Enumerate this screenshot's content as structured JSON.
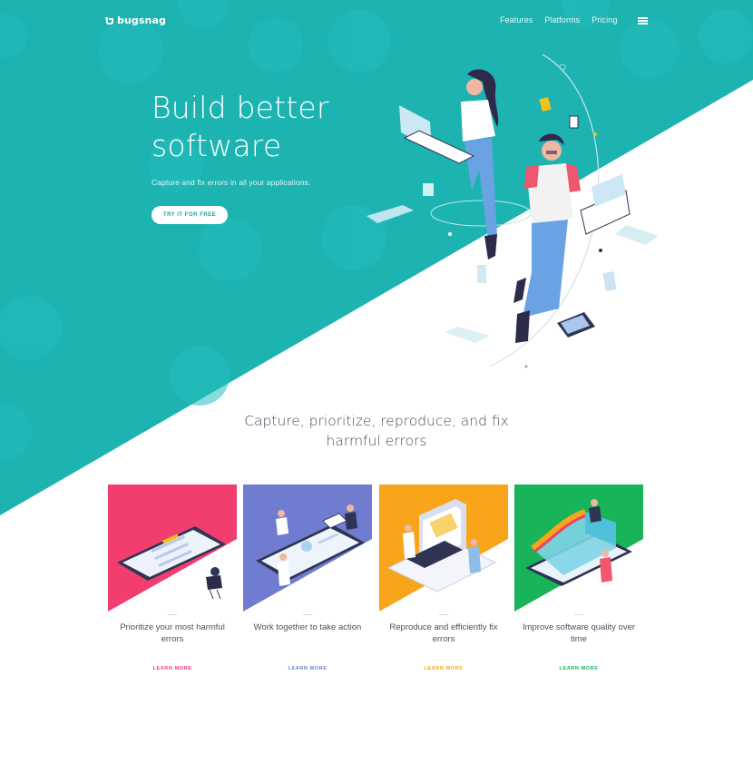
{
  "brand": {
    "name": "bugsnag"
  },
  "nav": {
    "items": [
      {
        "label": "Features"
      },
      {
        "label": "Platforms"
      },
      {
        "label": "Pricing"
      }
    ],
    "menu_icon": "hamburger-icon"
  },
  "hero": {
    "title": "Build better software",
    "subtitle": "Capture and fix errors in all your applications.",
    "cta_label": "TRY IT FOR FREE"
  },
  "features": {
    "heading": "Capture, prioritize, reproduce, and fix harmful errors",
    "cards": [
      {
        "text": "Prioritize your most harmful errors",
        "link": "LEARN MORE",
        "color": "#f23d6f"
      },
      {
        "text": "Work together to take action",
        "link": "LEARN MORE",
        "color": "#6f7ccf"
      },
      {
        "text": "Reproduce and efficiently fix errors",
        "link": "LEARN MORE",
        "color": "#f8a51b"
      },
      {
        "text": "Improve software quality over time",
        "link": "LEARN MORE",
        "color": "#19b45a"
      }
    ]
  },
  "colors": {
    "teal": "#1cb3b1",
    "white": "#ffffff"
  }
}
